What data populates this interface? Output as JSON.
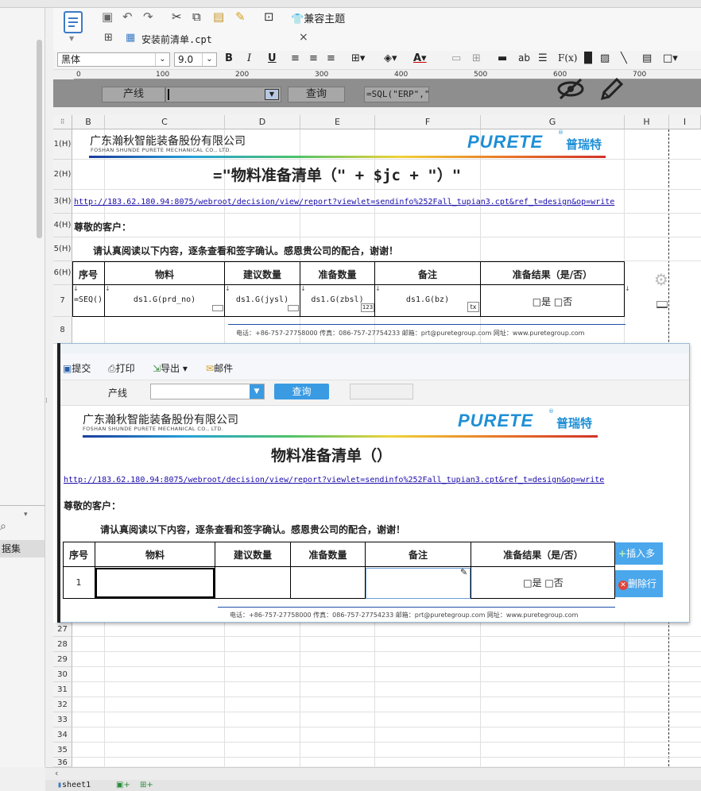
{
  "toolbar": {
    "compat_theme": "兼容主题"
  },
  "tab": {
    "name": "安装前清单.cpt",
    "close": "×"
  },
  "format": {
    "font": "黑体",
    "size": "9.0",
    "bold": "B",
    "italic": "I",
    "underline": "U",
    "ab": "ab",
    "fx": "F(x)"
  },
  "ruler": {
    "marks": [
      "0",
      "100",
      "200",
      "300",
      "400",
      "500",
      "600",
      "700"
    ]
  },
  "param_bar": {
    "label": "产线",
    "query": "查询",
    "sql": "=SQL(\"ERP\",\"s"
  },
  "columns": [
    "B",
    "C",
    "D",
    "E",
    "F",
    "G",
    "H",
    "I"
  ],
  "rows": {
    "top": [
      "1(H)",
      "2(H)",
      "3(H)",
      "4(H)",
      "5(H)",
      "6(H)",
      "7",
      "8"
    ],
    "bottom": [
      "27",
      "28",
      "29",
      "30",
      "31",
      "32",
      "33",
      "34",
      "35",
      "36"
    ]
  },
  "company": {
    "name_cn": "广东瀚秋智能装备股份有限公司",
    "name_en": "FOSHAN SHUNDE PURETE MECHANICAL CO., LTD.",
    "brand": "PURETE",
    "brand_cn": "普瑞特"
  },
  "design": {
    "title_formula": "=\"物料准备清单（\" + $jc + \"）\"",
    "url": "http://183.62.180.94:8075/webroot/decision/view/report?viewlet=sendinfo%252Fall_tupian3.cpt&ref_t=design&op=write",
    "greeting": "尊敬的客户：",
    "notice": "请认真阅读以下内容，逐条查看和签字确认。感恩贵公司的配合，谢谢！",
    "headers": [
      "序号",
      "物料",
      "建议数量",
      "准备数量",
      "备注",
      "准备结果（是/否）"
    ],
    "row7": [
      "=SEQ()",
      "ds1.G(prd_no)",
      "ds1.G(jysl)",
      "ds1.G(zbsl)",
      "ds1.G(bz)",
      "□是 □否"
    ],
    "badge_123": "123",
    "badge_tx": "tx",
    "footer": "电话：+86-757-27758000    传真：086-757-27754233    邮箱：prt@puretegroup.com    网址：www.puretegroup.com"
  },
  "preview": {
    "submit": "提交",
    "print": "打印",
    "export": "导出",
    "mail": "邮件",
    "param_label": "产线",
    "query": "查询",
    "title": "物料准备清单（）",
    "url": "http://183.62.180.94:8075/webroot/decision/view/report?viewlet=sendinfo%252Fall_tupian3.cpt&ref_t=design&op=write",
    "greeting": "尊敬的客户：",
    "notice": "请认真阅读以下内容，逐条查看和签字确认。感恩贵公司的配合，谢谢！",
    "headers": [
      "序号",
      "物料",
      "建议数量",
      "准备数量",
      "备注",
      "准备结果（是/否）"
    ],
    "row1_seq": "1",
    "row1_result": "□是 □否",
    "insert_btn": "插入多",
    "delete_btn": "删除行",
    "footer": "电话：+86-757-27758000    传真：086-757-27754233    邮箱：prt@puretegroup.com    网址：www.puretegroup.com"
  },
  "left_panel": {
    "label": "据集"
  },
  "sheets": {
    "sheet1": "sheet1"
  }
}
